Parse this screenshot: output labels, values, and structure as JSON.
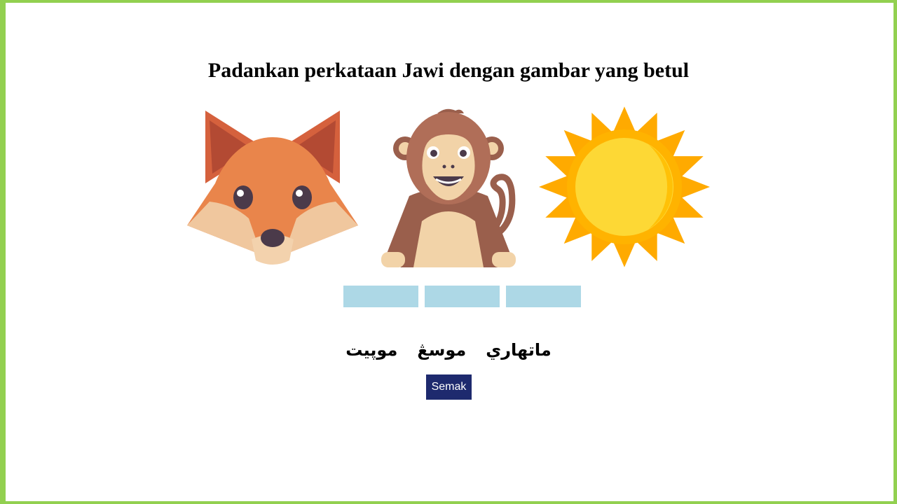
{
  "page": {
    "title": "Padankan perkataan Jawi dengan gambar yang betul"
  },
  "pictures": [
    {
      "icon": "fox-icon"
    },
    {
      "icon": "monkey-icon"
    },
    {
      "icon": "sun-icon"
    }
  ],
  "drop_zones": [
    {
      "value": ""
    },
    {
      "value": ""
    },
    {
      "value": ""
    }
  ],
  "words": [
    {
      "text": "ماتهاري"
    },
    {
      "text": "موسڠ"
    },
    {
      "text": "موپيت"
    }
  ],
  "check_button": {
    "label": "Semak"
  },
  "colors": {
    "border": "#92d050",
    "drop_zone": "#add8e6",
    "button": "#1e2a6e"
  }
}
